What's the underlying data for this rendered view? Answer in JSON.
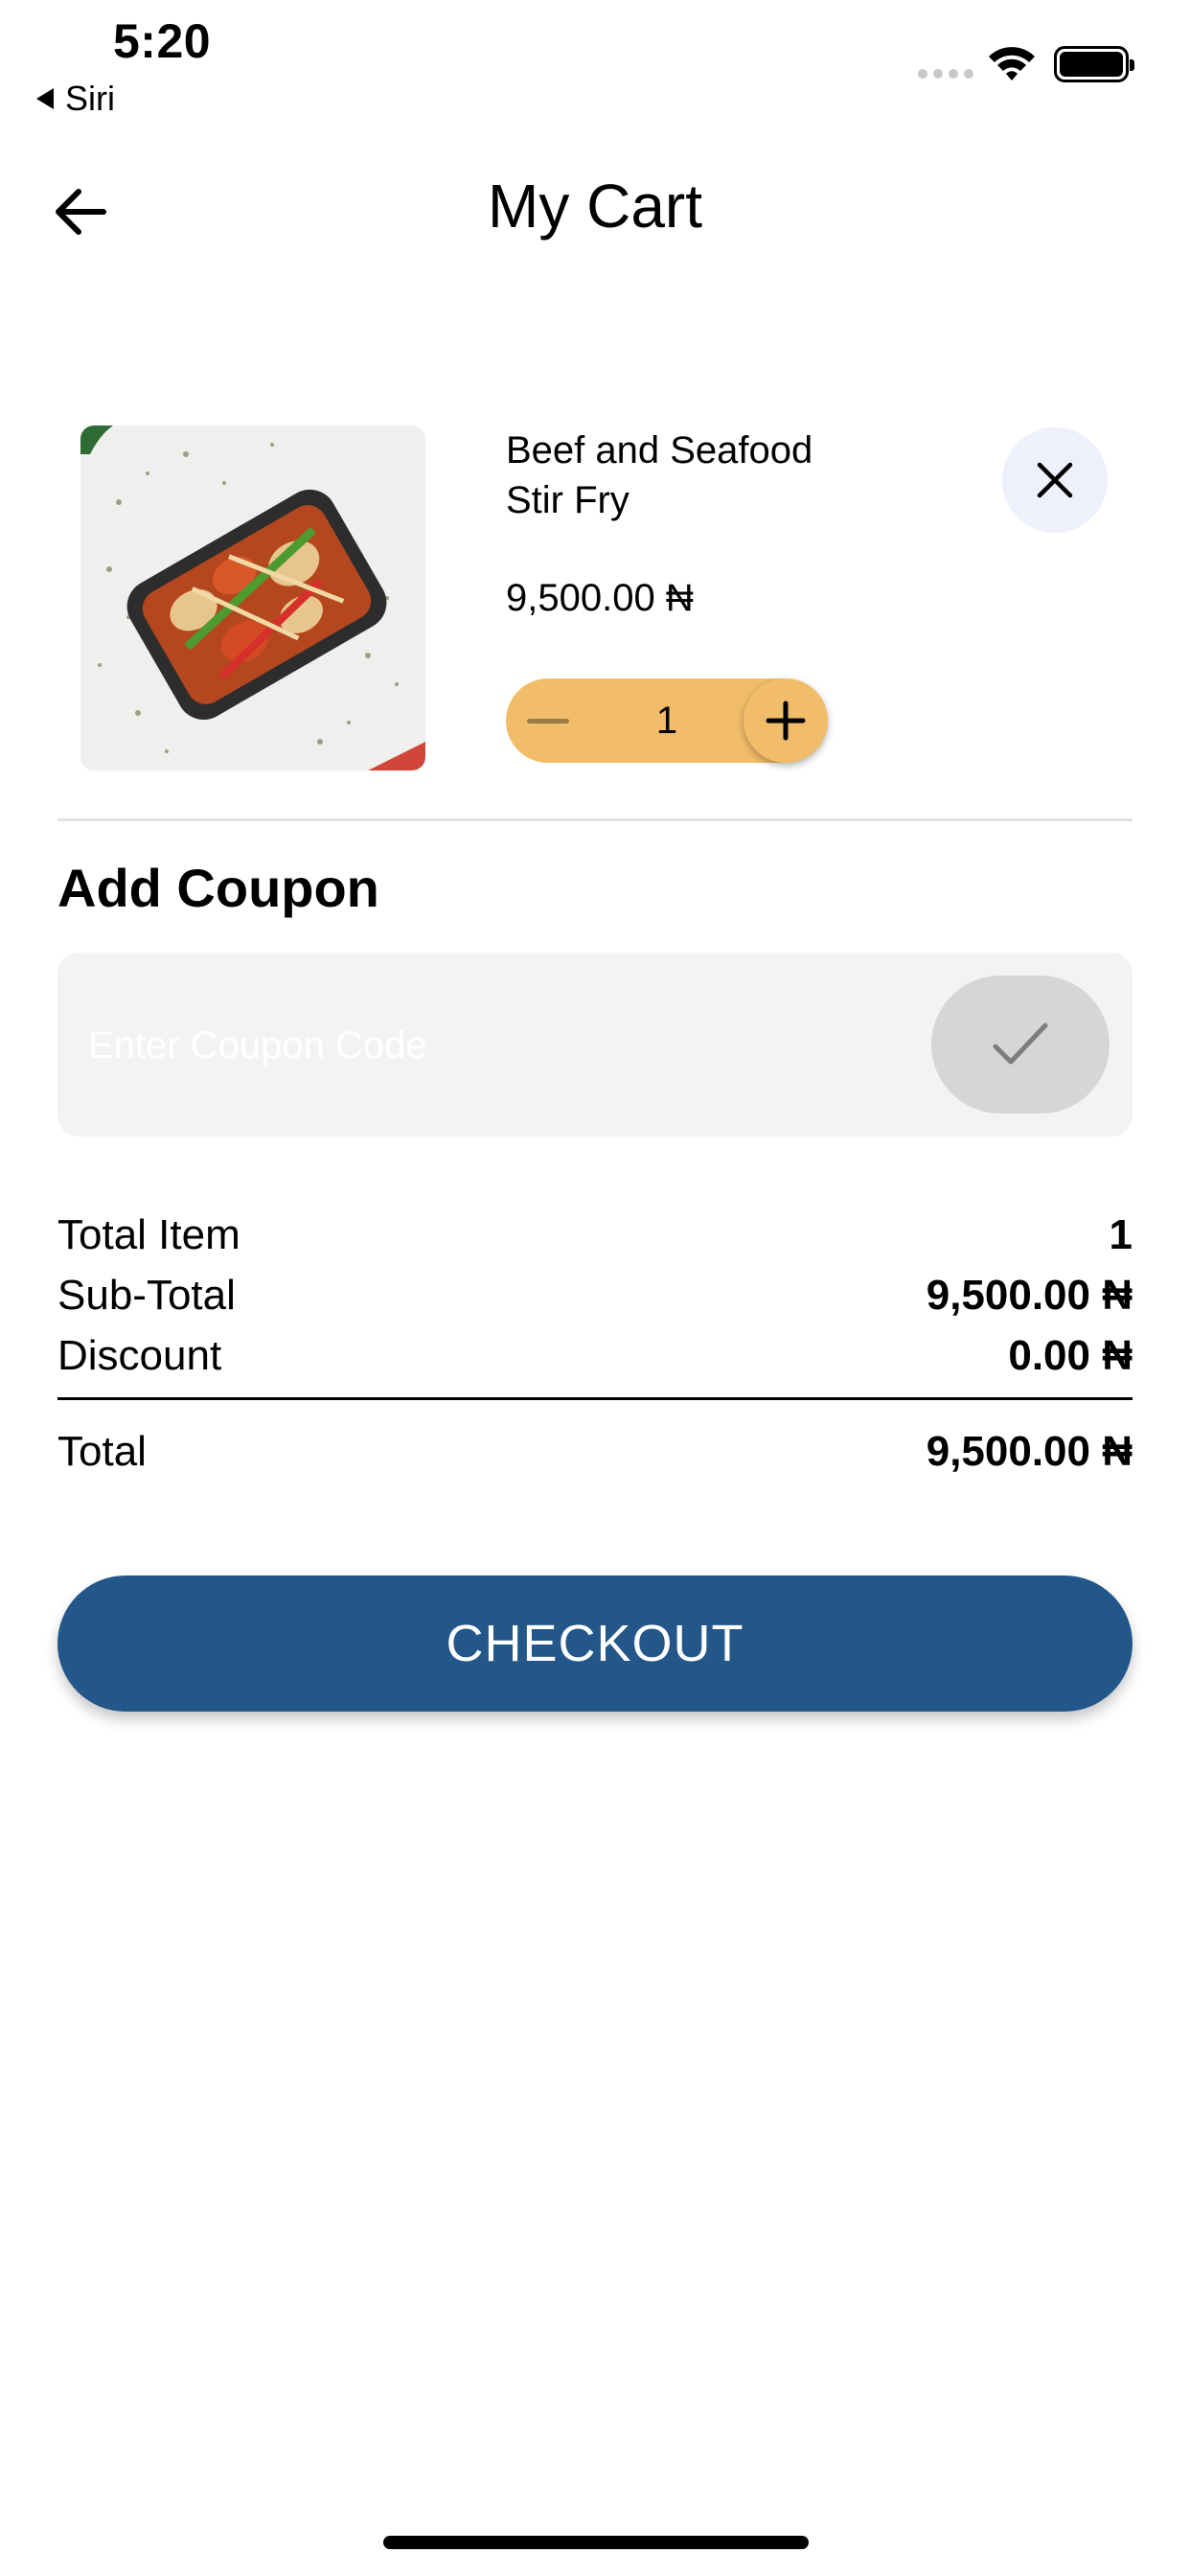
{
  "status_bar": {
    "time": "5:20",
    "back_app": "Siri",
    "icons": [
      "signal-dots-icon",
      "wifi-icon",
      "battery-icon"
    ]
  },
  "header": {
    "title": "My Cart",
    "back_icon": "arrow-left-icon"
  },
  "cart_item": {
    "name": " Beef and Seafood\nStir Fry",
    "price": "9,500.00 ₦",
    "quantity": "1",
    "image": "beef-seafood-stir-fry-photo",
    "remove_icon": "close-icon",
    "minus_icon": "minus-icon",
    "plus_icon": "plus-icon"
  },
  "coupon": {
    "title": "Add Coupon",
    "placeholder": "Enter Coupon Code",
    "value": "",
    "apply_icon": "check-icon"
  },
  "summary": {
    "total_item_label": "Total Item",
    "total_item_value": "1",
    "subtotal_label": "Sub-Total",
    "subtotal_value": "9,500.00 ₦",
    "discount_label": "Discount",
    "discount_value": "0.00 ₦",
    "total_label": "Total",
    "total_value": "9,500.00 ₦"
  },
  "checkout": {
    "label": "CHECKOUT"
  },
  "colors": {
    "accent": "#235789",
    "stepper": "#f2bd6a",
    "remove_bg": "#eef0fb",
    "coupon_bg": "#f3f3f3"
  }
}
